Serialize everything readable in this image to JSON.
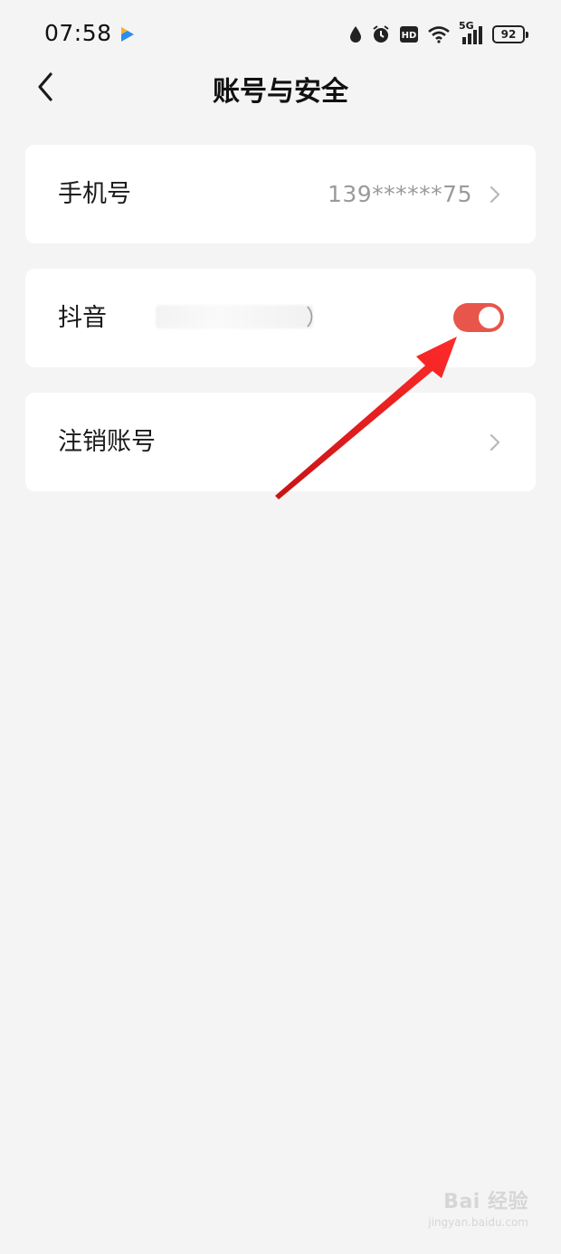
{
  "status_bar": {
    "time": "07:58",
    "network": "5G",
    "battery": "92",
    "icons": [
      "app-badge-icon",
      "water-drop-icon",
      "alarm-icon",
      "hd-icon",
      "wifi-icon",
      "signal-icon",
      "battery-icon"
    ]
  },
  "header": {
    "title": "账号与安全",
    "back_icon": "chevron-left-icon"
  },
  "rows": [
    {
      "label": "手机号",
      "value": "139******75",
      "icon": "chevron-right-icon"
    },
    {
      "label": "抖音",
      "paren_open": "（",
      "paren_close": "）",
      "toggle_on": true
    },
    {
      "label": "注销账号",
      "icon": "chevron-right-icon"
    }
  ],
  "colors": {
    "background": "#f4f4f4",
    "card": "#ffffff",
    "toggle_on": "#e8554a",
    "annotation_arrow": "#e11d1d",
    "secondary_text": "#9a9a9a"
  },
  "watermark": {
    "top": "Bai  经验",
    "bottom": "jingyan.baidu.com"
  }
}
